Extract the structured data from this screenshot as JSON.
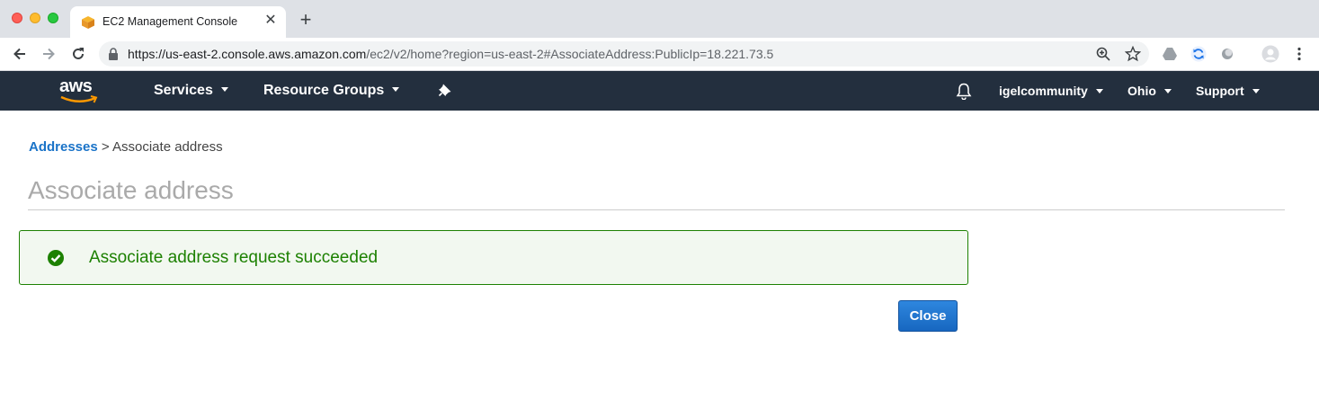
{
  "browser": {
    "tab_title": "EC2 Management Console",
    "tab_close_glyph": "✕",
    "new_tab_glyph": "+",
    "url_host": "https://us-east-2.console.aws.amazon.com",
    "url_path": "/ec2/v2/home?region=us-east-2#AssociateAddress:PublicIp=18.221.73.5",
    "icons": [
      "back-icon",
      "forward-icon",
      "reload-icon",
      "lock-icon",
      "zoom-icon",
      "bookmark-star-icon",
      "drive-extension-icon",
      "sync-extension-icon",
      "circle-extension-icon",
      "profile-avatar-icon",
      "menu-kebab-icon"
    ]
  },
  "awsnav": {
    "logo_text": "aws",
    "services": "Services",
    "resource_groups": "Resource Groups",
    "account": "igelcommunity",
    "region": "Ohio",
    "support": "Support",
    "colors": {
      "bar": "#232f3e",
      "logo_smile": "#ff9900"
    }
  },
  "page": {
    "breadcrumb_link": "Addresses",
    "breadcrumb_separator": ">",
    "breadcrumb_current": "Associate address",
    "title": "Associate address"
  },
  "alert": {
    "status": "success",
    "message": "Associate address request succeeded",
    "color": "#1d8102"
  },
  "actions": {
    "close_label": "Close"
  }
}
